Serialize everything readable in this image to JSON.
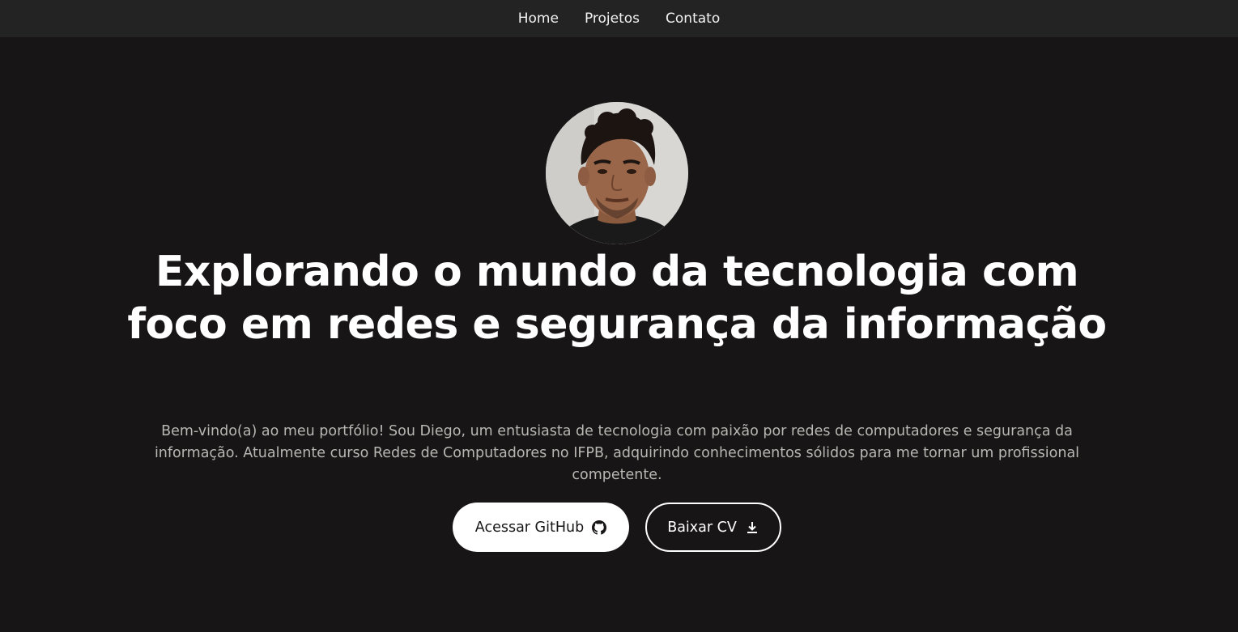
{
  "nav": {
    "items": [
      {
        "label": "Home"
      },
      {
        "label": "Projetos"
      },
      {
        "label": "Contato"
      }
    ]
  },
  "hero": {
    "title": "Explorando o mundo da tecnologia com foco em redes e segurança da informação",
    "description": "Bem-vindo(a) ao meu portfólio! Sou Diego, um entusiasta de tecnologia com paixão por redes de computadores e segurança da informação. Atualmente curso Redes de Computadores no IFPB, adquirindo conhecimentos sólidos para me tornar um profissional competente.",
    "buttons": {
      "github_label": "Acessar GitHub",
      "github_icon": "github-icon",
      "cv_label": "Baixar CV",
      "cv_icon": "download-icon"
    }
  },
  "colors": {
    "background": "#171515",
    "navbar": "#232323",
    "text": "#ffffff",
    "muted_text": "#b9b6b3",
    "button_primary_bg": "#ffffff",
    "button_primary_text": "#171515"
  }
}
